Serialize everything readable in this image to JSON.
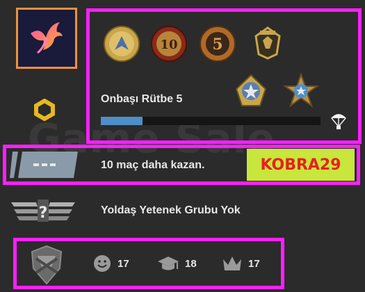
{
  "watermark": "Game Sale",
  "profile": {
    "avatar_icon": "bird-logo-icon",
    "level_icon": "profile-level-ring-icon"
  },
  "rank": {
    "coins": [
      "five-year-veteran-coin",
      "ten-year-veteran-coin",
      "five-year-coin",
      "global-offensive-badge"
    ],
    "medals": [
      "service-medal-silver",
      "service-medal-blue"
    ],
    "name": "Onbaşı Rütbe 5",
    "xp_progress": 0.19
  },
  "competitive": {
    "message": "10 maç daha kazan.",
    "code": "KOBRA29"
  },
  "skill": {
    "message": "Yoldaş Yetenek Grubu Yok"
  },
  "commendations": {
    "friendly": "17",
    "teacher": "18",
    "leader": "17"
  },
  "colors": {
    "highlight": "#ff1fff",
    "code_bg": "#c8e63c",
    "code_text": "#e82020",
    "xp_fill": "#4d8fc8"
  }
}
